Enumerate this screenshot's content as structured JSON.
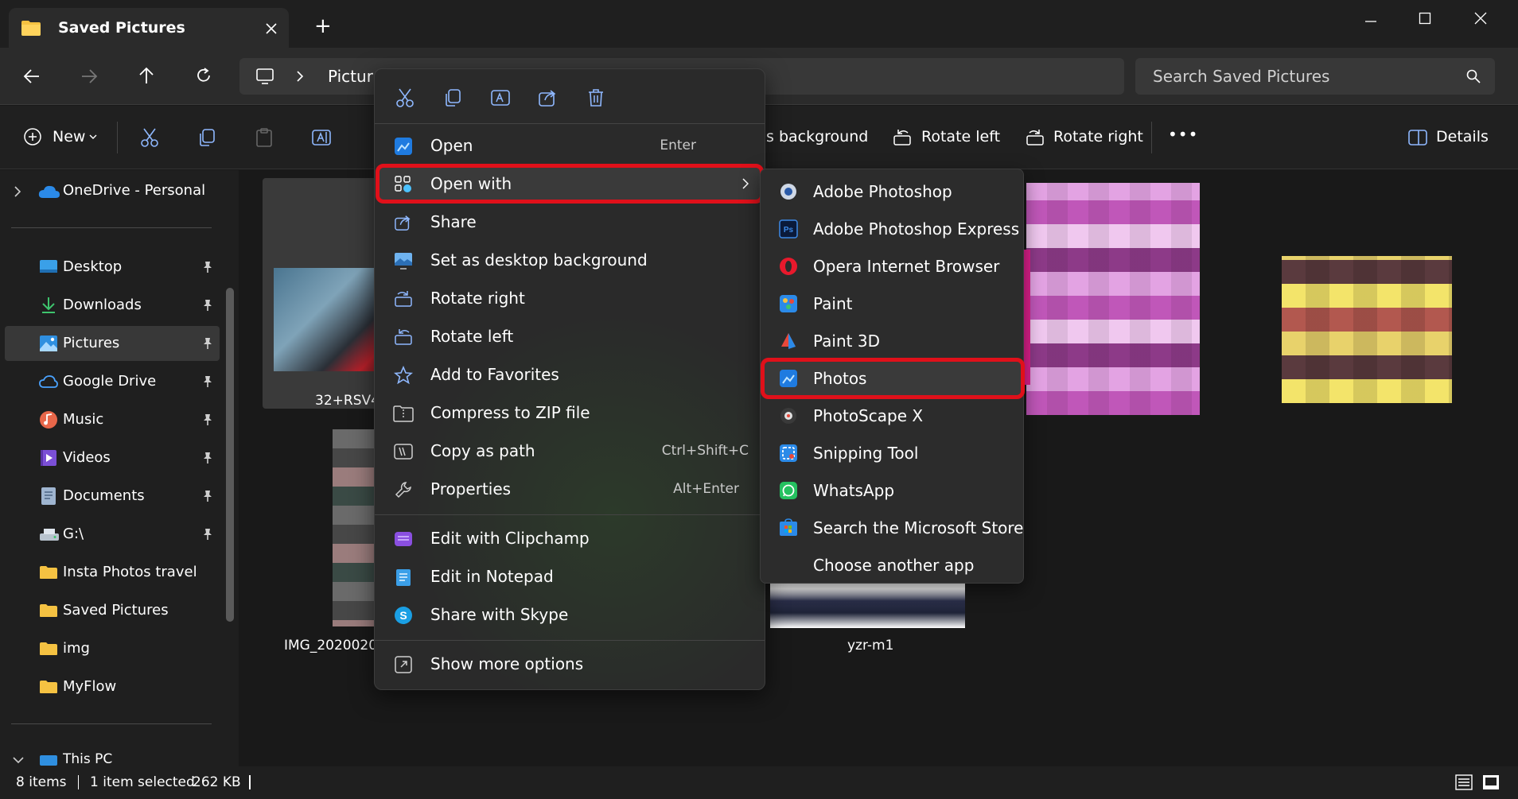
{
  "window": {
    "tab_title": "Saved Pictures",
    "new_tab_glyph": "+",
    "controls": [
      "minimize-icon",
      "maximize-icon",
      "close-icon"
    ]
  },
  "nav": {
    "address_partial": "Pictur",
    "search_placeholder": "Search Saved Pictures"
  },
  "commands": {
    "new_label": "New",
    "set_background_partial": "s background",
    "rotate_left_label": "Rotate left",
    "rotate_right_label": "Rotate right",
    "more_glyph": "•••",
    "details_label": "Details"
  },
  "sidebar": {
    "onedrive": "OneDrive - Personal",
    "items": [
      {
        "label": "Desktop",
        "icon": "desktop-icon",
        "pinned": true
      },
      {
        "label": "Downloads",
        "icon": "download-icon",
        "pinned": true
      },
      {
        "label": "Pictures",
        "icon": "pictures-icon",
        "pinned": true,
        "active": true
      },
      {
        "label": "Google Drive",
        "icon": "cloud-icon",
        "pinned": true
      },
      {
        "label": "Music",
        "icon": "music-icon",
        "pinned": true
      },
      {
        "label": "Videos",
        "icon": "videos-icon",
        "pinned": true
      },
      {
        "label": "Documents",
        "icon": "documents-icon",
        "pinned": true
      },
      {
        "label": "G:\\",
        "icon": "drive-icon",
        "pinned": true
      },
      {
        "label": "Insta Photos travel",
        "icon": "folder-icon",
        "pinned": false
      },
      {
        "label": "Saved Pictures",
        "icon": "folder-icon",
        "pinned": false
      },
      {
        "label": "img",
        "icon": "folder-icon",
        "pinned": false
      },
      {
        "label": "MyFlow",
        "icon": "folder-icon",
        "pinned": false
      }
    ],
    "this_pc": "This PC"
  },
  "files": {
    "captions": [
      "32+RSV4",
      "IMG_2020020",
      "yzr-m1"
    ]
  },
  "status": {
    "items": "8 items",
    "selected": "1 item selected",
    "size": "262 KB"
  },
  "context_menu": {
    "quick_actions": [
      "cut-icon",
      "copy-icon",
      "rename-icon",
      "share-icon",
      "delete-icon"
    ],
    "items": [
      {
        "label": "Open",
        "shortcut": "Enter",
        "icon": "photos-icon"
      },
      {
        "label": "Open with",
        "shortcut": "",
        "icon": "open-with-icon",
        "highlighted": true
      },
      {
        "label": "Share",
        "shortcut": "",
        "icon": "share-icon"
      },
      {
        "label": "Set as desktop background",
        "shortcut": "",
        "icon": "wallpaper-icon"
      },
      {
        "label": "Rotate right",
        "shortcut": "",
        "icon": "rotate-right-icon"
      },
      {
        "label": "Rotate left",
        "shortcut": "",
        "icon": "rotate-left-icon"
      },
      {
        "label": "Add to Favorites",
        "shortcut": "",
        "icon": "star-icon"
      },
      {
        "label": "Compress to ZIP file",
        "shortcut": "",
        "icon": "zip-icon"
      },
      {
        "label": "Copy as path",
        "shortcut": "Ctrl+Shift+C",
        "icon": "copy-path-icon"
      },
      {
        "label": "Properties",
        "shortcut": "Alt+Enter",
        "icon": "wrench-icon"
      }
    ],
    "extra_items": [
      {
        "label": "Edit with Clipchamp",
        "icon": "clipchamp-icon"
      },
      {
        "label": "Edit in Notepad",
        "icon": "notepad-icon"
      },
      {
        "label": "Share with Skype",
        "icon": "skype-icon"
      }
    ],
    "more_options": "Show more options"
  },
  "open_with": {
    "apps": [
      {
        "label": "Adobe Photoshop",
        "icon": "photoshop-icon"
      },
      {
        "label": "Adobe Photoshop Express",
        "icon": "photoshop-express-icon"
      },
      {
        "label": "Opera Internet Browser",
        "icon": "opera-icon"
      },
      {
        "label": "Paint",
        "icon": "paint-icon"
      },
      {
        "label": "Paint 3D",
        "icon": "paint3d-icon"
      },
      {
        "label": "Photos",
        "icon": "photos-icon",
        "highlighted": true
      },
      {
        "label": "PhotoScape X",
        "icon": "photoscape-icon"
      },
      {
        "label": "Snipping Tool",
        "icon": "snipping-tool-icon"
      },
      {
        "label": "WhatsApp",
        "icon": "whatsapp-icon"
      },
      {
        "label": "Search the Microsoft Store",
        "icon": "store-icon"
      },
      {
        "label": "Choose another app",
        "icon": ""
      }
    ]
  },
  "colors": {
    "highlight_outline": "#e0101a",
    "folder": "#f5c242",
    "accent": "#4cc2ff"
  }
}
